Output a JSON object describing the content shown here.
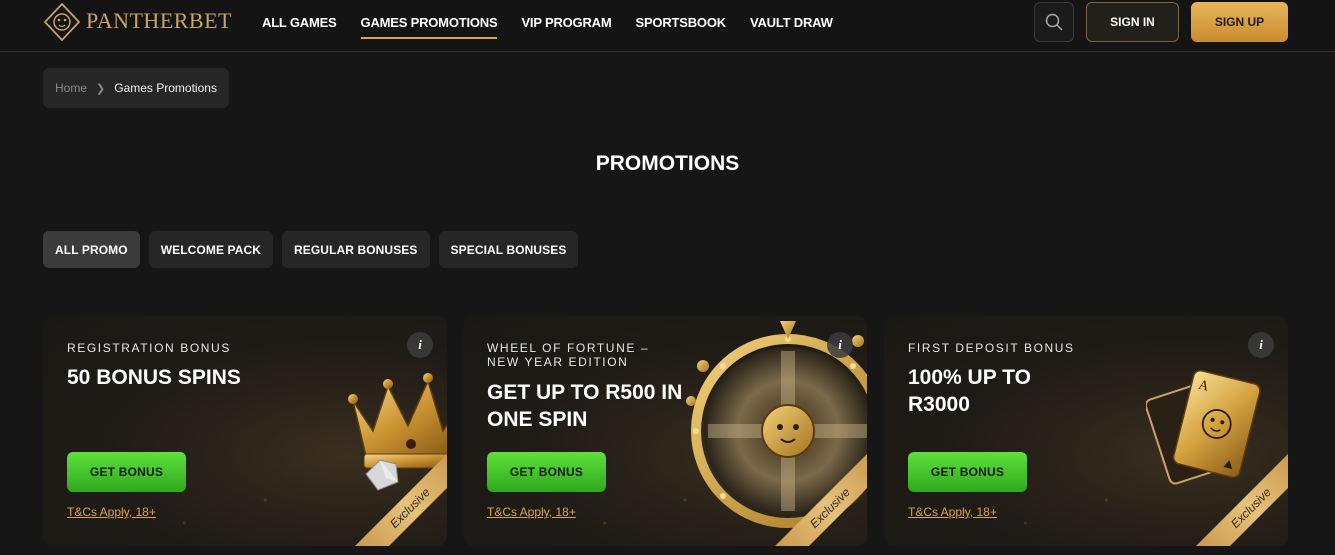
{
  "brand": {
    "name": "PANTHERBET"
  },
  "nav": {
    "items": [
      {
        "label": "ALL GAMES",
        "active": false
      },
      {
        "label": "GAMES PROMOTIONS",
        "active": true
      },
      {
        "label": "VIP PROGRAM",
        "active": false
      },
      {
        "label": "SPORTSBOOK",
        "active": false
      },
      {
        "label": "VAULT DRAW",
        "active": false
      }
    ],
    "search_icon": "search-icon",
    "signin_label": "SIGN IN",
    "signup_label": "SIGN UP"
  },
  "breadcrumb": {
    "home": "Home",
    "current": "Games Promotions"
  },
  "page": {
    "title": "PROMOTIONS"
  },
  "filters": [
    {
      "label": "ALL PROMO",
      "active": true
    },
    {
      "label": "WELCOME PACK",
      "active": false
    },
    {
      "label": "REGULAR BONUSES",
      "active": false
    },
    {
      "label": "SPECIAL BONUSES",
      "active": false
    }
  ],
  "cards": [
    {
      "eyebrow": "REGISTRATION BONUS",
      "title": "50 BONUS SPINS",
      "button": "GET BONUS",
      "terms": "T&Cs Apply, 18+",
      "ribbon": "Exclusive",
      "art": "crown-icon"
    },
    {
      "eyebrow": "WHEEL OF FORTUNE – NEW YEAR EDITION",
      "title": "GET UP TO R500 IN ONE SPIN",
      "button": "GET BONUS",
      "terms": "T&Cs Apply, 18+",
      "ribbon": "Exclusive",
      "art": "fortune-wheel-icon"
    },
    {
      "eyebrow": "FIRST DEPOSIT BONUS",
      "title": "100% UP TO R3000",
      "button": "GET BONUS",
      "terms": "T&Cs Apply, 18+",
      "ribbon": "Exclusive",
      "art": "playing-cards-icon"
    }
  ],
  "colors": {
    "accent_gold": "#d9a54a",
    "cta_green": "#4cc82c",
    "background": "#161616"
  }
}
